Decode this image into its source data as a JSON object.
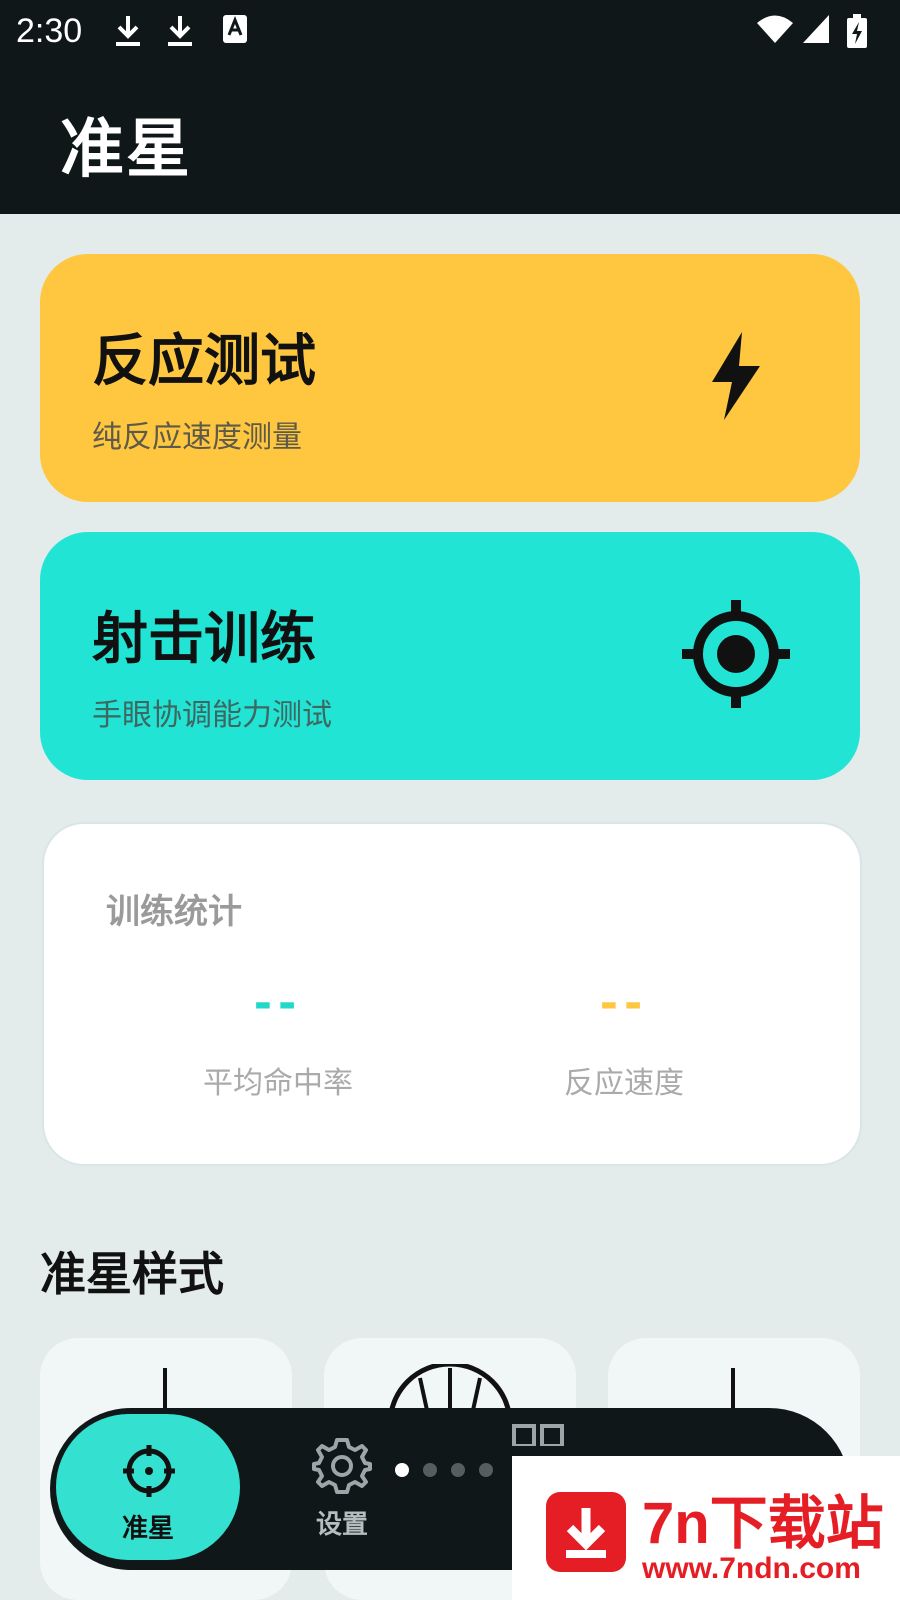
{
  "status_bar": {
    "time": "2:30"
  },
  "app_bar": {
    "title": "准星"
  },
  "cards": {
    "reaction": {
      "title": "反应测试",
      "subtitle": "纯反应速度测量",
      "icon": "lightning-icon",
      "color": "#fec73f"
    },
    "shooting": {
      "title": "射击训练",
      "subtitle": "手眼协调能力测试",
      "icon": "crosshair-icon",
      "color": "#21e4d4"
    }
  },
  "stats": {
    "title": "训练统计",
    "items": [
      {
        "value": "--",
        "label": "平均命中率",
        "color": "#21d8cb"
      },
      {
        "value": "--",
        "label": "反应速度",
        "color": "#fec73f"
      }
    ]
  },
  "crosshair_styles": {
    "title": "准星样式"
  },
  "bottom_nav": {
    "items": [
      {
        "label": "准星",
        "icon": "crosshair-icon",
        "active": true
      },
      {
        "label": "设置",
        "icon": "gear-icon",
        "active": false
      }
    ],
    "pager_dots": 4,
    "active_dot": 0
  },
  "watermark": {
    "brand": "7n下载站",
    "url": "www.7ndn.com"
  }
}
